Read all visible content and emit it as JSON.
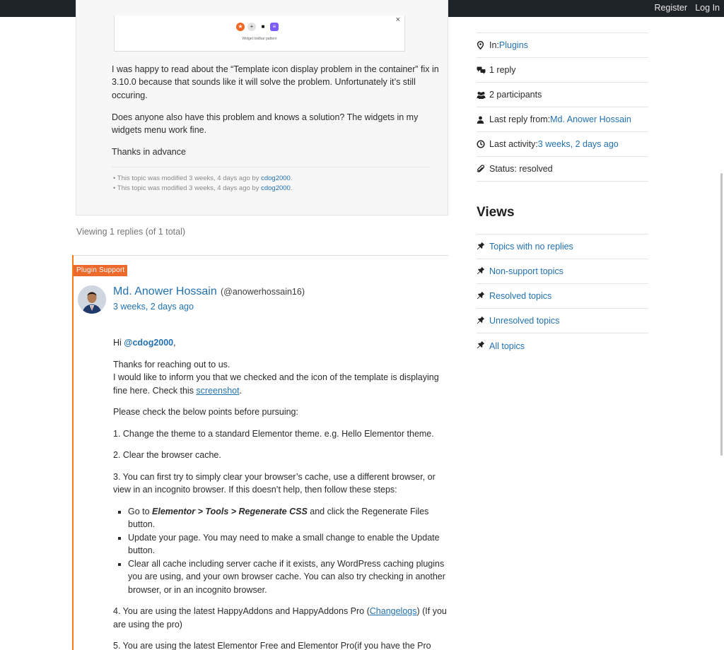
{
  "topbar": {
    "register": "Register",
    "login": "Log In"
  },
  "embed": {
    "caption": "Widget toolbar pattern",
    "close": "×"
  },
  "topic": {
    "p1": "I was happy to read about the “Template icon display problem in the container” fix in 3.10.0 because that sounds like it will solve the problem. Unfortunately it’s still occuring.",
    "p2": "Does anyone also have this problem and knows a solution? The widgets in my widgets menu work fine.",
    "p3": "Thanks in advance",
    "revisions": [
      {
        "text": "This topic was modified 3 weeks, 4 days ago by ",
        "user": "cdog2000",
        "end": "."
      },
      {
        "text": "This topic was modified 3 weeks, 4 days ago by ",
        "user": "cdog2000",
        "end": "."
      }
    ]
  },
  "viewing": "Viewing 1 replies (of 1 total)",
  "reply": {
    "badge": "Plugin Support",
    "author": "Md. Anower Hossain",
    "handle": "(@anowerhossain16)",
    "date": "3 weeks, 2 days ago",
    "hi": "Hi ",
    "mention": "@cdog2000",
    "comma": ",",
    "thanks": "Thanks for reaching out to us.",
    "inform": "I would like to inform you that we checked and the icon of the template is displaying fine here. Check this ",
    "screenshot_link": "screenshot",
    "period": ".",
    "check_points": "Please check the below points before pursuing:",
    "point1": "1. Change the theme to a standard Elementor theme. e.g. Hello Elementor theme.",
    "point2": "2. Clear the browser cache.",
    "point3": "3. You can first try to simply clear your browser’s cache, use a different browser, or view in an incognito browser. If this doesn’t help, then follow these steps:",
    "step1_pre": "Go to ",
    "step1_path": "Elementor > Tools > Regenerate CSS",
    "step1_post": " and click the Regenerate Files button.",
    "step2": "Update your page. You may need to make a small change to enable the Update button.",
    "step3": "Clear all cache including server cache if it exists, any WordPress caching plugins you are using, and your own browser cache. You can also try checking in another browser, or in an incognito browser.",
    "point4_pre": "4. You are using the latest HappyAddons and HappyAddons Pro (",
    "point4_link": "Changelogs",
    "point4_post": ") (If you are using the pro)",
    "point5": "5. You are using the latest Elementor Free and Elementor Pro(if you have the Pro"
  },
  "sidebar": {
    "in_label": "In: ",
    "in_value": "Plugins",
    "replies": "1 reply",
    "participants": "2 participants",
    "last_reply_label": "Last reply from: ",
    "last_reply_value": "Md. Anower Hossain",
    "last_activity_label": "Last activity: ",
    "last_activity_value": "3 weeks, 2 days ago",
    "status": "Status: resolved",
    "views_title": "Views",
    "views": [
      "Topics with no replies",
      "Non-support topics",
      "Resolved topics",
      "Unresolved topics",
      "All topics"
    ]
  }
}
